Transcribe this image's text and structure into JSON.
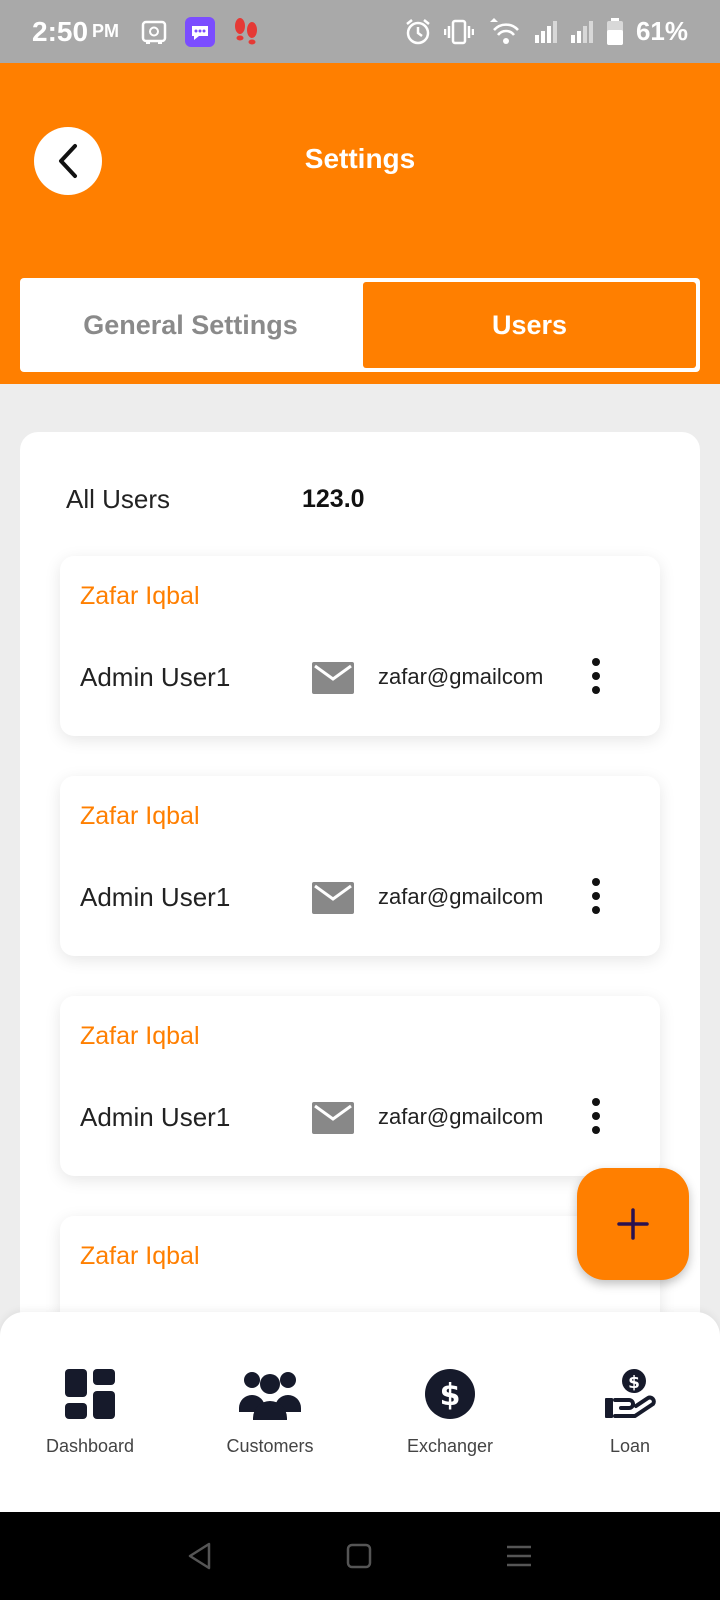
{
  "status_bar": {
    "time": "2:50",
    "ampm": "PM",
    "battery": "61%"
  },
  "header": {
    "title": "Settings"
  },
  "tabs": [
    {
      "label": "General Settings",
      "active": false
    },
    {
      "label": "Users",
      "active": true
    }
  ],
  "summary": {
    "label": "All Users",
    "count": "123.0"
  },
  "users": [
    {
      "name": "Zafar Iqbal",
      "role": "Admin User1",
      "email": "zafar@gmailcom"
    },
    {
      "name": "Zafar Iqbal",
      "role": "Admin User1",
      "email": "zafar@gmailcom"
    },
    {
      "name": "Zafar Iqbal",
      "role": "Admin User1",
      "email": "zafar@gmailcom"
    },
    {
      "name": "Zafar Iqbal",
      "role": "",
      "email": ""
    }
  ],
  "bottom_nav": [
    {
      "label": "Dashboard",
      "icon": "dashboard-icon"
    },
    {
      "label": "Customers",
      "icon": "customers-icon"
    },
    {
      "label": "Exchanger",
      "icon": "dollar-circle-icon"
    },
    {
      "label": "Loan",
      "icon": "loan-hand-icon"
    }
  ],
  "colors": {
    "accent": "#ff7f00",
    "status_bar": "#a9a9a9",
    "background": "#ededed"
  }
}
